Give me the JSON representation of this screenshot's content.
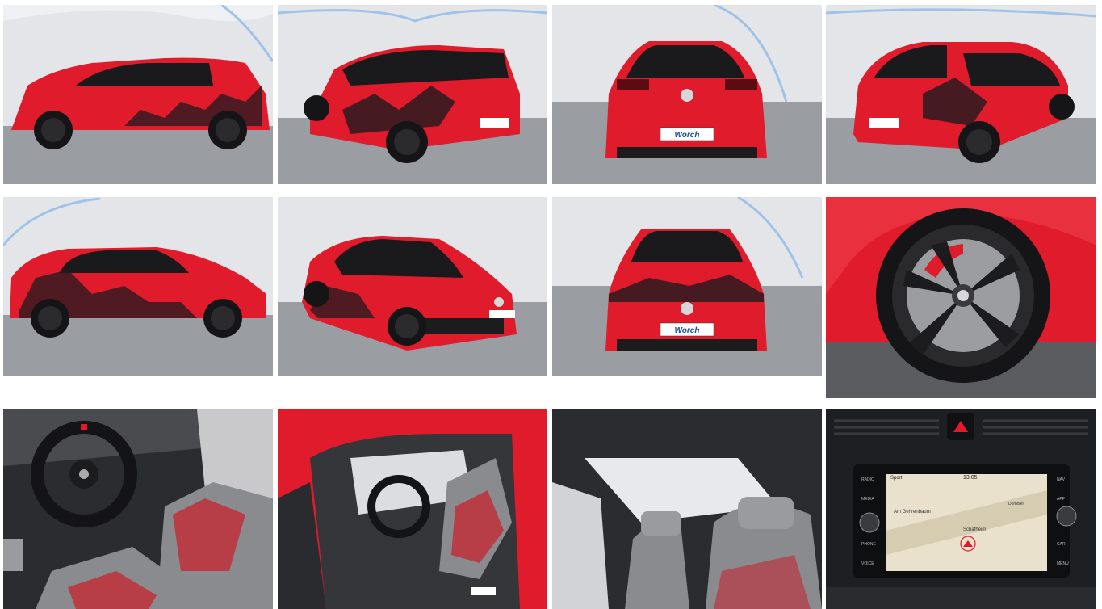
{
  "gallery": {
    "photos": [
      {
        "view": "side-left",
        "plate": ""
      },
      {
        "view": "rear-three-quarter-left",
        "plate": ""
      },
      {
        "view": "rear",
        "plate": "Worch"
      },
      {
        "view": "rear-three-quarter-right",
        "plate": ""
      },
      {
        "view": "side-right",
        "plate": ""
      },
      {
        "view": "front-three-quarter-right",
        "plate": ""
      },
      {
        "view": "front",
        "plate": "Worch"
      },
      {
        "view": "wheel-closeup",
        "plate": ""
      },
      {
        "view": "interior-cockpit",
        "plate": ""
      },
      {
        "view": "interior-driver-door",
        "plate": ""
      },
      {
        "view": "panoramic-roof",
        "plate": ""
      },
      {
        "view": "infotainment",
        "plate": ""
      }
    ]
  },
  "infotainment": {
    "time": "13:05",
    "mode": "Sport",
    "street": "Am Gehrenbaum",
    "place": "Schafheim",
    "place2": "Dorndiel",
    "menu_left": [
      "RADIO",
      "MEDIA",
      "PHONE",
      "VOICE"
    ],
    "menu_right": [
      "NAV",
      "APP",
      "CAR",
      "MENU"
    ]
  },
  "colors": {
    "car_red": "#e01b2b",
    "dark": "#1c1c1e",
    "showroom": "#dcdde0",
    "floor": "#8e9196"
  }
}
